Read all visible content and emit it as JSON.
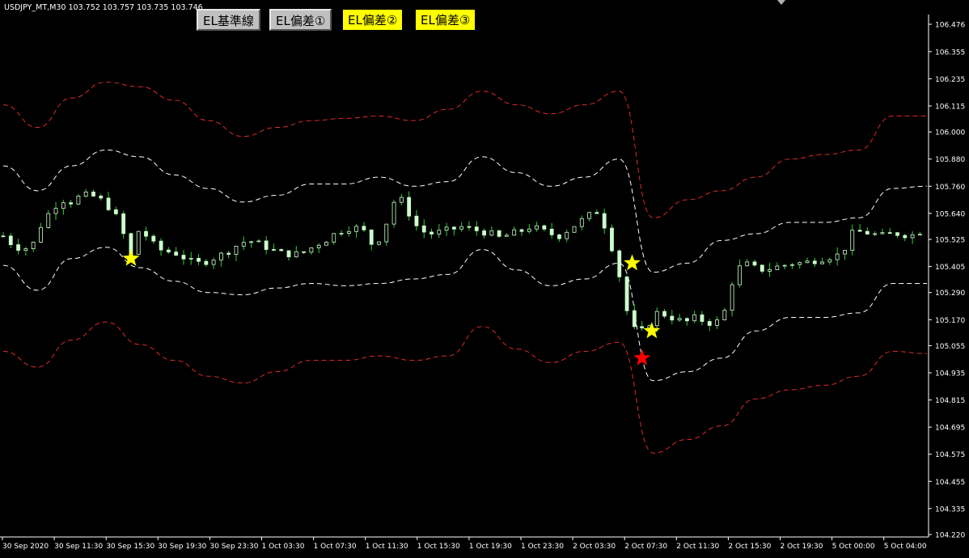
{
  "window": {
    "symbol_info": "USDJPY_MT,M30  103.752 103.757 103.735 103.746"
  },
  "buttons": [
    {
      "label": "EL基準線",
      "style": "grey"
    },
    {
      "label": "EL偏差①",
      "style": "grey"
    },
    {
      "label": "EL偏差②",
      "style": "yellow"
    },
    {
      "label": "EL偏差③",
      "style": "yellow"
    }
  ],
  "colors": {
    "background": "#000000",
    "candle_body": "#ccffcc",
    "candle_wick": "#33cc33",
    "band_outer": "#dd2a2a",
    "band_inner": "#ffffff",
    "star_yellow": "#ffff00",
    "star_red": "#ff0000",
    "axis": "#ffffff"
  },
  "chart_data": {
    "type": "candlestick",
    "symbol": "USDJPY_MT",
    "timeframe": "M30",
    "ylim": [
      104.2,
      106.51
    ],
    "y_ticks": [
      "106.476",
      "106.355",
      "106.235",
      "106.115",
      "106.000",
      "105.880",
      "105.760",
      "105.640",
      "105.525",
      "105.405",
      "105.290",
      "105.170",
      "105.055",
      "104.935",
      "104.815",
      "104.695",
      "104.575",
      "104.455",
      "104.335",
      "104.220"
    ],
    "x_ticks": [
      "30 Sep 2020",
      "30 Sep 11:30",
      "30 Sep 15:30",
      "30 Sep 19:30",
      "30 Sep 23:30",
      "1 Oct 03:30",
      "1 Oct 07:30",
      "1 Oct 11:30",
      "1 Oct 15:30",
      "1 Oct 19:30",
      "1 Oct 23:30",
      "2 Oct 03:30",
      "2 Oct 07:30",
      "2 Oct 11:30",
      "2 Oct 15:30",
      "2 Oct 19:30",
      "5 Oct 00:00",
      "5 Oct 04:00"
    ],
    "close_path": [
      105.54,
      105.5,
      105.48,
      105.5,
      105.6,
      105.66,
      105.7,
      105.69,
      105.72,
      105.72,
      105.7,
      105.66,
      105.6,
      105.44,
      105.58,
      105.52,
      105.48,
      105.47,
      105.46,
      105.43,
      105.42,
      105.43,
      105.45,
      105.47,
      105.5,
      105.52,
      105.51,
      105.49,
      105.47,
      105.46,
      105.46,
      105.47,
      105.5,
      105.52,
      105.55,
      105.57,
      105.58,
      105.56,
      105.49,
      105.56,
      105.69,
      105.7,
      105.6,
      105.56,
      105.55,
      105.56,
      105.57,
      105.58,
      105.57,
      105.56,
      105.55,
      105.53,
      105.55,
      105.56,
      105.58,
      105.57,
      105.55,
      105.54,
      105.57,
      105.6,
      105.63,
      105.65,
      105.55,
      105.4,
      105.2,
      105.1,
      105.14,
      105.2,
      105.19,
      105.17,
      105.16,
      105.18,
      105.16,
      105.15,
      105.21,
      105.38,
      105.42,
      105.4,
      105.39,
      105.4,
      105.41,
      105.42,
      105.42,
      105.43,
      105.44,
      105.45,
      105.46,
      105.55,
      105.56,
      105.55,
      105.54,
      105.55,
      105.55,
      105.54,
      105.56
    ],
    "candles_per_tick": 6.9,
    "bands": {
      "outer_upper": [
        106.12,
        106.02,
        106.15,
        106.22,
        106.2,
        106.14,
        106.05,
        105.98,
        106.02,
        106.05,
        106.06,
        106.07,
        106.05,
        106.1,
        106.18,
        106.12,
        106.08,
        106.12,
        106.18,
        105.62,
        105.7,
        105.74,
        105.8,
        105.88,
        105.9,
        105.92,
        106.07,
        106.07
      ],
      "inner_upper": [
        105.85,
        105.74,
        105.85,
        105.92,
        105.89,
        105.81,
        105.75,
        105.69,
        105.72,
        105.77,
        105.77,
        105.8,
        105.76,
        105.78,
        105.89,
        105.82,
        105.76,
        105.8,
        105.88,
        105.38,
        105.42,
        105.52,
        105.55,
        105.6,
        105.6,
        105.62,
        105.75,
        105.76
      ],
      "inner_lower": [
        105.41,
        105.3,
        105.44,
        105.49,
        105.4,
        105.34,
        105.29,
        105.28,
        105.31,
        105.33,
        105.32,
        105.33,
        105.35,
        105.37,
        105.48,
        105.39,
        105.32,
        105.35,
        105.42,
        104.9,
        104.94,
        105.0,
        105.12,
        105.18,
        105.18,
        105.2,
        105.33,
        105.33
      ],
      "outer_lower": [
        105.03,
        104.96,
        105.08,
        105.16,
        105.06,
        104.99,
        104.92,
        104.89,
        104.94,
        104.99,
        104.99,
        105.01,
        104.99,
        105.01,
        105.14,
        105.04,
        104.98,
        105.03,
        105.07,
        104.58,
        104.64,
        104.7,
        104.82,
        104.86,
        104.88,
        104.92,
        105.03,
        105.02
      ]
    },
    "signals": [
      {
        "color": "yellow",
        "candle_index": 13,
        "price": 105.44
      },
      {
        "color": "yellow",
        "candle_index": 64,
        "price": 105.42
      },
      {
        "color": "yellow",
        "candle_index": 66,
        "price": 105.12
      },
      {
        "color": "red",
        "candle_index": 65,
        "price": 105.0
      }
    ]
  }
}
